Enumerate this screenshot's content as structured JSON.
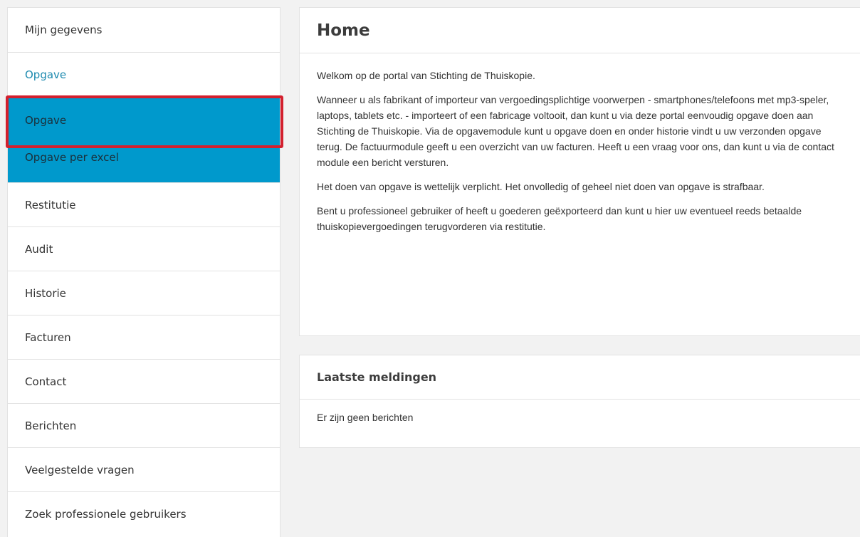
{
  "sidebar": {
    "items": [
      {
        "label": "Mijn gegevens"
      },
      {
        "label": "Opgave"
      },
      {
        "label": "Restitutie"
      },
      {
        "label": "Audit"
      },
      {
        "label": "Historie"
      },
      {
        "label": "Facturen"
      },
      {
        "label": "Contact"
      },
      {
        "label": "Berichten"
      },
      {
        "label": "Veelgestelde vragen"
      },
      {
        "label": "Zoek professionele gebruikers"
      }
    ],
    "subitems": [
      {
        "label": "Opgave"
      },
      {
        "label": "Opgave per excel"
      }
    ]
  },
  "colors": {
    "accent": "#0099cc",
    "active_text": "#1d8aaf",
    "highlight_border": "#d3202e"
  },
  "home": {
    "title": "Home",
    "paragraphs": [
      "Welkom op de portal van Stichting de Thuiskopie.",
      "Wanneer u als fabrikant of importeur van vergoedingsplichtige voorwerpen -  smartphones/telefoons met mp3-speler, laptops, tablets etc. -  importeert of een fabricage voltooit, dan kunt u via deze portal eenvoudig opgave doen aan Stichting de Thuiskopie. Via de opgavemodule kunt u opgave doen en onder historie vindt u uw verzonden opgave terug. De factuurmodule geeft u een overzicht van uw facturen. Heeft u een vraag voor ons, dan kunt u via de contact module een bericht versturen.",
      "Het doen van opgave is wettelijk verplicht. Het onvolledig of geheel niet doen van opgave is strafbaar.",
      "Bent u professioneel gebruiker of heeft u goederen geëxporteerd dan kunt u hier uw eventueel reeds betaalde thuiskopievergoedingen terugvorderen via restitutie."
    ]
  },
  "notifications": {
    "title": "Laatste meldingen",
    "empty_text": "Er zijn geen berichten"
  }
}
